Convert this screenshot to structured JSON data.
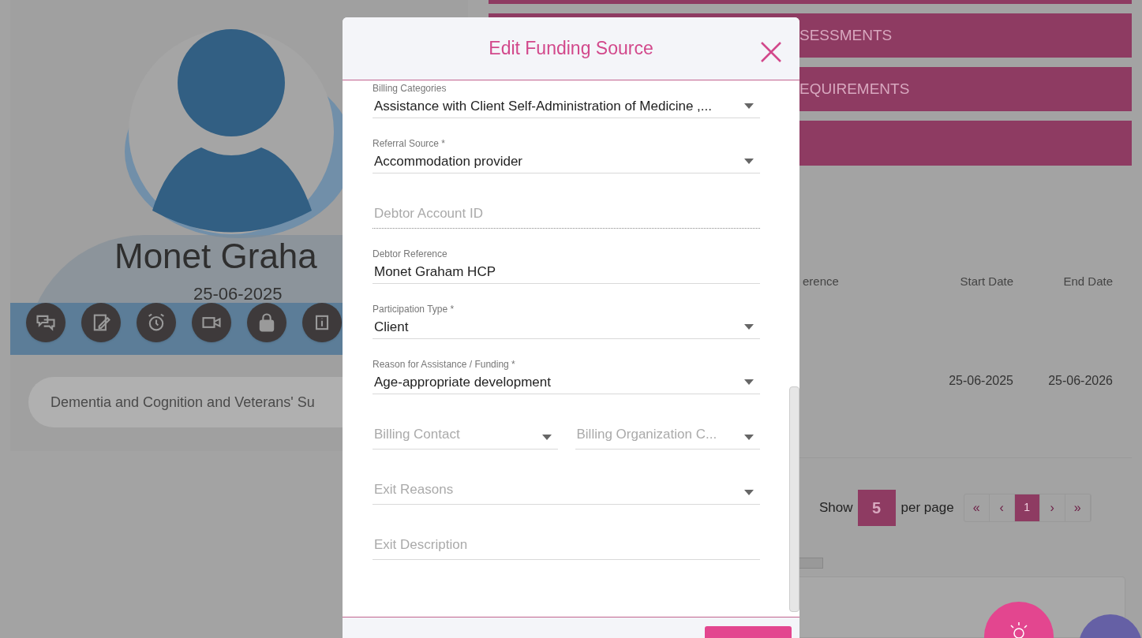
{
  "background": {
    "profile": {
      "name": "Monet Graha",
      "date": "25-06-2025",
      "funding_tag": "Dementia and Cognition and Veterans' Su"
    },
    "sections": [
      "SESSMENTS",
      "EQUIREMENTS"
    ],
    "table": {
      "columns": [
        "erence",
        "Start Date",
        "End Date"
      ],
      "rows": [
        {
          "column_2": "25-06-2025",
          "column_3": "25-06-2026"
        }
      ]
    },
    "pagination": {
      "show_label": "Show",
      "page_size": "5",
      "per_page_label": "per page",
      "pages": [
        {
          "label": "«",
          "selected": false
        },
        {
          "label": "‹",
          "selected": false
        },
        {
          "label": "1",
          "selected": true
        },
        {
          "label": "›",
          "selected": false
        },
        {
          "label": "»",
          "selected": false
        }
      ]
    }
  },
  "modal": {
    "title": "Edit Funding Source",
    "fields": [
      {
        "kind": "select",
        "label": "Billing Categories",
        "value": "Assistance with Client Self-Administration of Medicine ,...",
        "disabled": false
      },
      {
        "kind": "select",
        "label": "Referral Source *",
        "value": "Accommodation provider",
        "disabled": false
      },
      {
        "kind": "text",
        "placeholder": "Debtor Account ID",
        "disabled": true
      },
      {
        "kind": "text",
        "label": "Debtor Reference",
        "value": "Monet Graham HCP",
        "disabled": false
      },
      {
        "kind": "select",
        "label": "Participation Type *",
        "value": "Client",
        "disabled": false
      },
      {
        "kind": "select",
        "label": "Reason for Assistance / Funding *",
        "value": "Age-appropriate development",
        "disabled": false
      },
      {
        "kind": "pair",
        "items": [
          {
            "kind": "select",
            "placeholder": "Billing Contact",
            "disabled": false
          },
          {
            "kind": "select",
            "placeholder": "Billing Organization C...",
            "disabled": false
          }
        ]
      },
      {
        "kind": "select",
        "placeholder": "Exit Reasons",
        "disabled": false
      },
      {
        "kind": "text",
        "placeholder": "Exit Description",
        "disabled": false
      }
    ]
  }
}
